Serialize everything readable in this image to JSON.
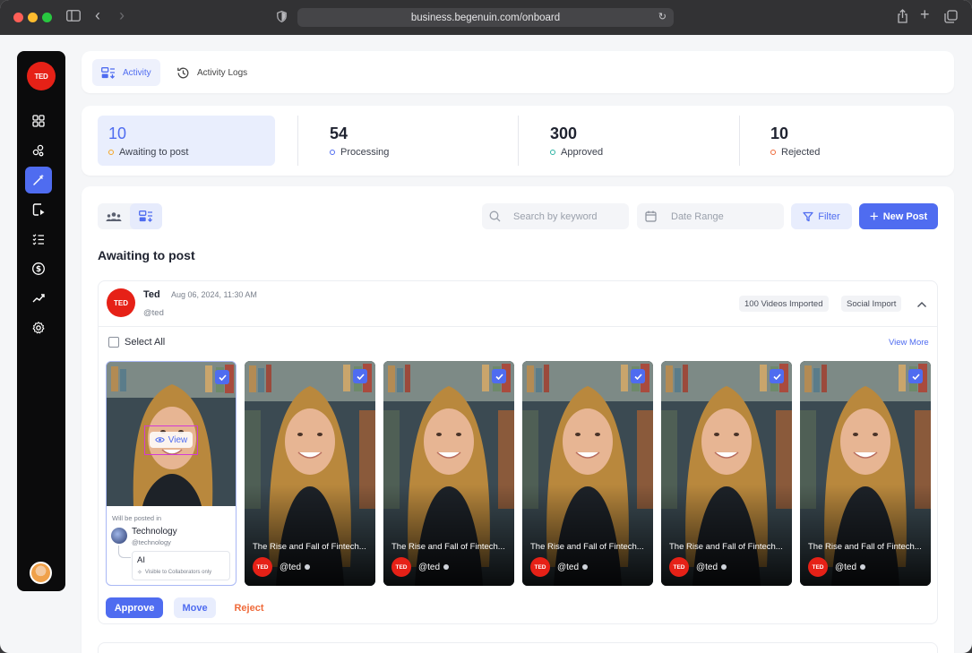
{
  "browser": {
    "url": "business.begenuin.com/onboard"
  },
  "sidebar": {
    "logo": "TED",
    "items": [
      "dashboard-icon",
      "communities-icon",
      "magic-pen-icon",
      "video-play-icon",
      "checklist-icon",
      "dollar-icon",
      "analytics-icon",
      "settings-icon"
    ],
    "active_index": 2
  },
  "tabs": [
    {
      "label": "Activity",
      "active": true
    },
    {
      "label": "Activity Logs",
      "active": false
    }
  ],
  "stats": [
    {
      "value": "10",
      "label": "Awaiting to post",
      "color": "#f5a524"
    },
    {
      "value": "54",
      "label": "Processing",
      "color": "#4f6cf0"
    },
    {
      "value": "300",
      "label": "Approved",
      "color": "#2bb3a3"
    },
    {
      "value": "10",
      "label": "Rejected",
      "color": "#ef6a3a"
    }
  ],
  "toolbar": {
    "search_placeholder": "Search by keyword",
    "date_placeholder": "Date Range",
    "filter_label": "Filter",
    "new_post_label": "New Post"
  },
  "section_title": "Awaiting to post",
  "post": {
    "author": "Ted",
    "date": "Aug 06, 2024, 11:30 AM",
    "handle": "@ted",
    "chips": [
      "100 Videos Imported",
      "Social Import"
    ],
    "select_all": "Select All",
    "view_more": "View More",
    "view_label": "View",
    "will_be_posted": "Will be posted in",
    "community": {
      "name": "Technology",
      "handle": "@technology"
    },
    "sub": {
      "name": "AI",
      "note": "Visible to Collaborators only"
    },
    "video_title": "The Rise and Fall of Fintech...",
    "video_handle": "@ted",
    "actions": {
      "approve": "Approve",
      "move": "Move",
      "reject": "Reject"
    }
  },
  "colors": {
    "accent": "#4f6cf0",
    "brand": "#e62117",
    "reject": "#ef6a3a"
  }
}
